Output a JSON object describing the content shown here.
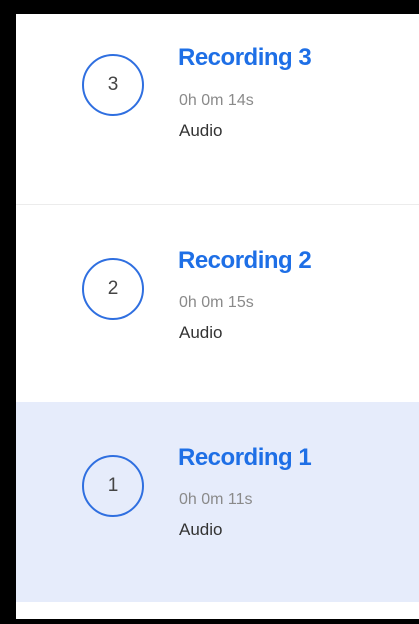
{
  "recordings": [
    {
      "number": "3",
      "title": "Recording 3",
      "duration": "0h 0m 14s",
      "type": "Audio",
      "selected": false
    },
    {
      "number": "2",
      "title": "Recording 2",
      "duration": "0h 0m 15s",
      "type": "Audio",
      "selected": false
    },
    {
      "number": "1",
      "title": "Recording 1",
      "duration": "0h 0m 11s",
      "type": "Audio",
      "selected": true
    }
  ],
  "colors": {
    "accent": "#1e6fe6",
    "circle_border": "#2f6fe0",
    "selected_background": "#e6ecfb",
    "frame": "#000000"
  }
}
